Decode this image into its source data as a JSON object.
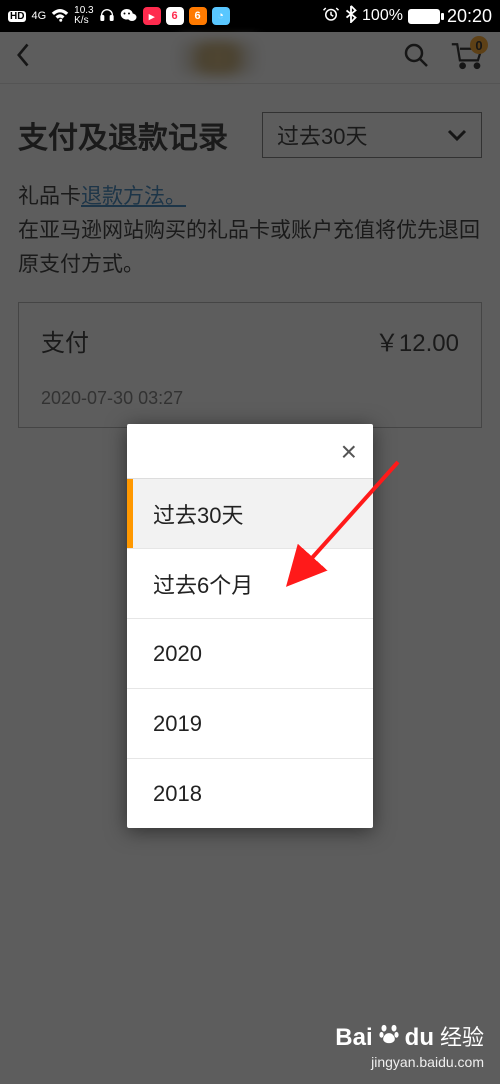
{
  "status_bar": {
    "hd": "HD",
    "net_gen": "4G",
    "speed_top": "10.3",
    "speed_unit": "K/s",
    "alarm_icon": "alarm-icon",
    "bt_icon": "bluetooth-icon",
    "battery_pct": "100%",
    "time": "20:20"
  },
  "header": {
    "cart_count": "0"
  },
  "page": {
    "title": "支付及退款记录",
    "filter_current": "过去30天",
    "gift_prefix": "礼品卡",
    "gift_link": "退款方法。",
    "gift_note": "在亚马逊网站购买的礼品卡或账户充值将优先退回原支付方式。",
    "record": {
      "type": "支付",
      "amount": "￥12.00",
      "date": "2020-07-30 03:27"
    }
  },
  "popup": {
    "close": "×",
    "options": [
      "过去30天",
      "过去6个月",
      "2020",
      "2019",
      "2018"
    ],
    "selected_index": 0
  },
  "watermark": {
    "brand": "Baidu",
    "brand2": "经验",
    "url": "jingyan.baidu.com"
  }
}
